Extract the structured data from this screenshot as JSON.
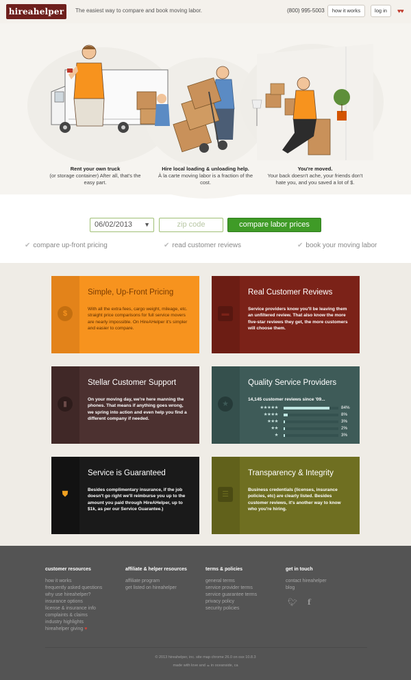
{
  "header": {
    "logo": "hireahelper",
    "tagline": "The easiest way to compare and book moving labor.",
    "phone": "(800) 995-5003",
    "how_it_works": "how it works",
    "login": "log in",
    "hearts_icon": "hearts-icon"
  },
  "hero": {
    "steps": [
      {
        "title": "Rent your own truck",
        "text": "(or storage container) After all, that's the easy part."
      },
      {
        "title": "Hire local loading & unloading help.",
        "text": "À la carte moving labor is a fraction of the cost."
      },
      {
        "title": "You're moved.",
        "text": "Your back doesn't ache, your friends don't hate you, and you saved a lot of $."
      }
    ]
  },
  "search": {
    "date": "06/02/2013",
    "zip_placeholder": "zip code",
    "button": "compare labor prices",
    "checks": [
      "compare up-front pricing",
      "read customer reviews",
      "book your moving labor"
    ]
  },
  "cards": {
    "pricing": {
      "title": "Simple, Up-Front Pricing",
      "body": "With all the extra fees, cargo weight, mileage, etc. straight price comparisons for full service movers are nearly impossible. On HireAHelper it's simpler and easier to compare.",
      "icon": "dollar-coin-icon"
    },
    "reviews": {
      "title": "Real Customer Reviews",
      "body": "Service providers know you'll be leaving them an unfiltered review. That also know the more five-star reviews they get, the more customers will choose them.",
      "icon": "speech-bubble-icon"
    },
    "support": {
      "title": "Stellar Customer Support",
      "body": "On your moving day, we're here manning the phones. That means if anything goes wrong, we spring into action and even help you find a different company if needed.",
      "icon": "phone-icon"
    },
    "quality": {
      "title": "Quality Service Providers",
      "reviews_header": "14,145 customer reviews since '09...",
      "ratings": [
        {
          "stars": "★★★★★",
          "percent_label": "84%",
          "percent": 84
        },
        {
          "stars": "★★★★",
          "percent_label": "8%",
          "percent": 8
        },
        {
          "stars": "★★★",
          "percent_label": "3%",
          "percent": 3
        },
        {
          "stars": "★★",
          "percent_label": "2%",
          "percent": 2
        },
        {
          "stars": "★",
          "percent_label": "3%",
          "percent": 3
        }
      ],
      "icon": "star-icon"
    },
    "guaranteed": {
      "title": "Service is Guaranteed",
      "body": "Besides complimentary insurance, if the job doesn't go right we'll reimburse you up to the amount you paid through HireAHelper, up to $1k, as per our Service Guarantee.)",
      "icon": "shield-icon"
    },
    "transparency": {
      "title": "Transparency & Integrity",
      "body": "Business credentials (licenses, insurance policies, etc) are clearly listed. Besides customer reviews, it's another way to know who you're hiring.",
      "icon": "id-card-icon"
    }
  },
  "footer": {
    "columns": [
      {
        "heading": "customer resources",
        "links": [
          "how it works",
          "frequently asked questions",
          "why use hireahelper?",
          "insurance options",
          "license & insurance info",
          "complaints & claims",
          "industry highlights",
          "hireahelper giving"
        ]
      },
      {
        "heading": "affiliate & helper resources",
        "links": [
          "affiliate program",
          "get listed on hireahelper"
        ]
      },
      {
        "heading": "terms & policies",
        "links": [
          "general terms",
          "service provider terms",
          "service guarantee terms",
          "privacy policy",
          "security policies"
        ]
      },
      {
        "heading": "get in touch",
        "links": [
          "contact hireahelper",
          "blog"
        ]
      }
    ],
    "copyright": "© 2013 hireahelper, inc.   site map   chrome 26.0 on osx 10.8.3",
    "made_with": "made with love and ☕ in oceanside, ca"
  },
  "colors": {
    "brand": "#6e1f1c",
    "cta_green": "#3f9b27",
    "pricing_orange": "#f7931e",
    "reviews_red": "#7b2218",
    "support_brown": "#4c3130",
    "quality_teal": "#3e5b58",
    "guarantee_black": "#1a1a1a",
    "transparency_olive": "#6f6f21",
    "footer_gray": "#545454"
  }
}
